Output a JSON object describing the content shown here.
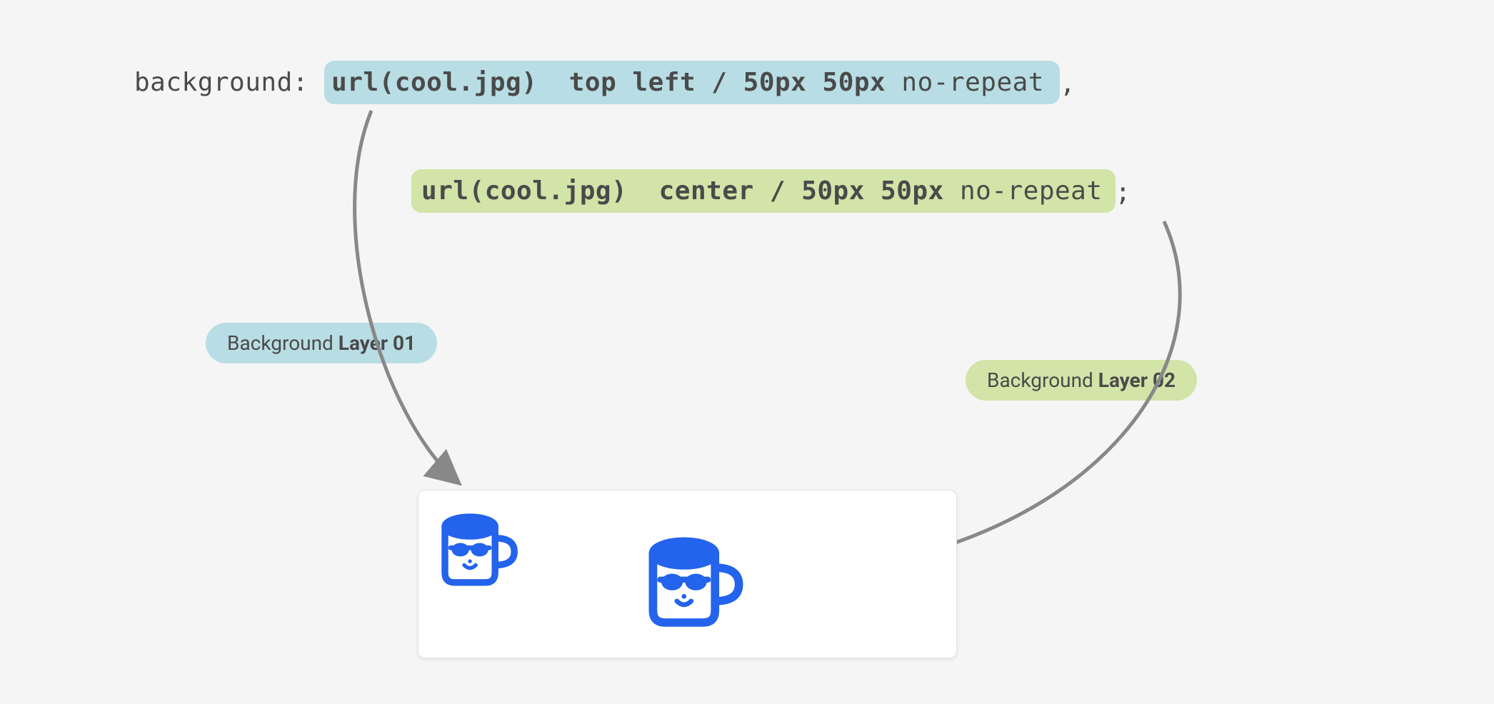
{
  "css": {
    "property": "background:",
    "layer1": {
      "url_bold": "url(cool.jpg)",
      "pos_bold": "top left / 50px 50px",
      "repeat": "no-repeat",
      "trailing": ","
    },
    "layer2": {
      "url_bold": "url(cool.jpg)",
      "pos_bold": "center / 50px 50px",
      "repeat": "no-repeat",
      "trailing": ";"
    }
  },
  "badges": {
    "layer1_prefix": "Background ",
    "layer1_bold": "Layer 01",
    "layer2_prefix": "Background ",
    "layer2_bold": "Layer 02"
  },
  "colors": {
    "blue_highlight": "#b9dde4",
    "green_highlight": "#d2e4a8",
    "arrow": "#888888",
    "mug_blue": "#2463eb"
  }
}
